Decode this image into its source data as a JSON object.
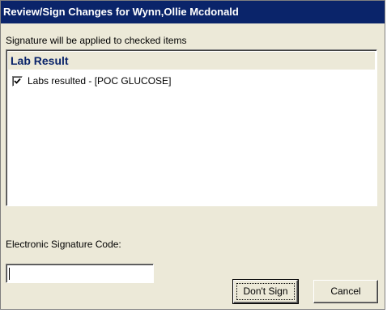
{
  "window": {
    "title": "Review/Sign Changes for Wynn,Ollie Mcdonald"
  },
  "instructions": "Signature will be applied to checked items",
  "list": {
    "group_header": "Lab Result",
    "items": [
      {
        "label": "Labs resulted - [POC GLUCOSE]",
        "checked": true
      }
    ]
  },
  "signature": {
    "label": "Electronic Signature Code:",
    "value": ""
  },
  "buttons": {
    "dont_sign": "Don't Sign",
    "cancel": "Cancel"
  },
  "colors": {
    "titlebar": "#0a246a",
    "dialog_face": "#ece9d8",
    "group_header_text": "#0a246a"
  }
}
